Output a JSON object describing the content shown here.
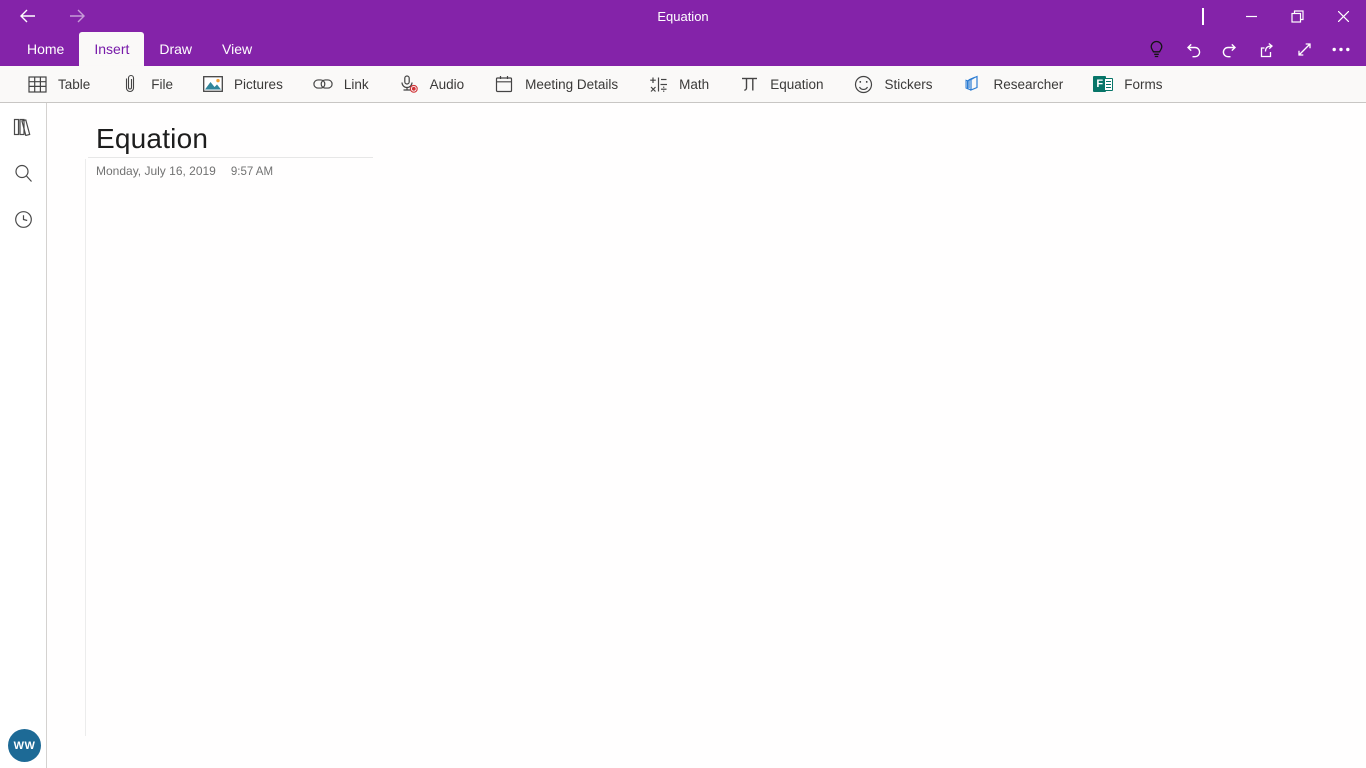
{
  "titlebar": {
    "window_title": "Equation",
    "nav": {
      "back": "back-arrow-icon",
      "forward": "forward-arrow-icon"
    },
    "window_controls": [
      "minimize",
      "restore",
      "close"
    ]
  },
  "tabs": [
    {
      "label": "Home",
      "active": false
    },
    {
      "label": "Insert",
      "active": true
    },
    {
      "label": "Draw",
      "active": false
    },
    {
      "label": "View",
      "active": false
    }
  ],
  "quick_actions": [
    "lightbulb",
    "undo",
    "redo",
    "share",
    "fullscreen",
    "more"
  ],
  "ribbon": {
    "items": [
      {
        "label": "Table",
        "icon": "table-icon"
      },
      {
        "label": "File",
        "icon": "paperclip-icon"
      },
      {
        "label": "Pictures",
        "icon": "pictures-icon"
      },
      {
        "label": "Link",
        "icon": "link-icon"
      },
      {
        "label": "Audio",
        "icon": "audio-icon"
      },
      {
        "label": "Meeting Details",
        "icon": "meeting-details-icon"
      },
      {
        "label": "Math",
        "icon": "math-icon"
      },
      {
        "label": "Equation",
        "icon": "equation-icon"
      },
      {
        "label": "Stickers",
        "icon": "stickers-icon"
      },
      {
        "label": "Researcher",
        "icon": "researcher-icon"
      },
      {
        "label": "Forms",
        "icon": "forms-icon"
      }
    ],
    "forms_letter": "F"
  },
  "sidebar": {
    "icons": [
      "notebooks",
      "search",
      "recent-notes"
    ]
  },
  "page": {
    "title": "Equation",
    "date": "Monday, July 16, 2019",
    "time": "9:57 AM"
  },
  "user": {
    "initials": "WW",
    "avatar_color": "#1d6a96"
  },
  "colors": {
    "titlebar_purple": "#8423a9",
    "accent_purple": "#771aa9",
    "ribbon_bg": "#faf9f8",
    "forms_teal": "#077568",
    "researcher_blue": "#2b7cd3",
    "audio_record_red": "#d13438",
    "pictures_teal": "#31869b",
    "pictures_sun_orange": "#f2a33a"
  }
}
